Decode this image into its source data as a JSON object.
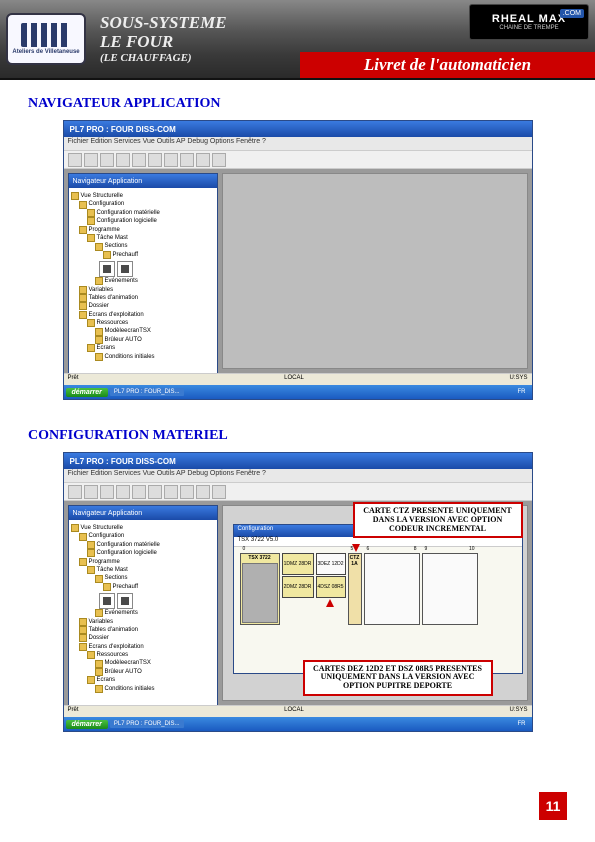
{
  "header": {
    "logo_text": "Ateliers de Villetaneuse",
    "title_l1": "SOUS-SYSTEME",
    "title_l2": "LE FOUR",
    "title_l3": "(LE CHAUFFAGE)",
    "red_banner": "Livret de l'automaticien",
    "brand_l1": "RHEAL",
    "brand_l2": "MAX",
    "brand_com": ".COM",
    "brand_sub": "CHAINE DE TREMPE"
  },
  "sections": {
    "nav_app": "NAVIGATEUR APPLICATION",
    "config_mat": "CONFIGURATION MATERIEL"
  },
  "appwin": {
    "title": "PL7 PRO : FOUR DISS-COM",
    "menu": "Fichier  Edition  Services  Vue  Outils  AP  Debug  Options  Fenêtre  ?",
    "nav_title": "Navigateur Application",
    "status_left": "Prêt",
    "status_mid": "LOCAL",
    "status_right": "U:SYS",
    "taskbar_start": "démarrer",
    "taskbar_task1": "PL7 PRO : FOUR_DIS...",
    "taskbar_tray": "FR"
  },
  "tree": [
    {
      "d": 0,
      "label": "Vue Structurelle"
    },
    {
      "d": 1,
      "label": "Configuration"
    },
    {
      "d": 2,
      "label": "Configuration matérielle"
    },
    {
      "d": 2,
      "label": "Configuration logicielle"
    },
    {
      "d": 1,
      "label": "Programme"
    },
    {
      "d": 2,
      "label": "Tâche Mast"
    },
    {
      "d": 3,
      "label": "Sections"
    },
    {
      "d": 4,
      "label": "Prechauff"
    },
    {
      "d": 3,
      "label": "Evénements"
    },
    {
      "d": 1,
      "label": "Variables"
    },
    {
      "d": 1,
      "label": "Tables d'animation"
    },
    {
      "d": 1,
      "label": "Dossier"
    },
    {
      "d": 1,
      "label": "Ecrans d'exploitation"
    },
    {
      "d": 2,
      "label": "Ressources"
    },
    {
      "d": 3,
      "label": "ModèleecranTSX"
    },
    {
      "d": 3,
      "label": "Brûleur AUTO"
    },
    {
      "d": 2,
      "label": "Ecrans"
    },
    {
      "d": 3,
      "label": "Conditions initiales"
    }
  ],
  "config": {
    "window_title": "Configuration",
    "rack_label": "TSX 3722 V5.0",
    "slots": {
      "cpu_idx": "0",
      "cpu_name": "TSX 3722",
      "cpu_body": "",
      "col_a_top_idx": "1",
      "col_a_top": "DMZ 28DR",
      "col_a_bot_idx": "2",
      "col_a_bot": "DMZ 28DR",
      "col_b_top_idx": "3",
      "col_b_top": "DEZ 12D2",
      "col_b_mid_idx": "4",
      "col_b_mid": "DSZ 08R5",
      "col_c_idx": "5",
      "col_c": "CTZ 1A",
      "col_d_idx_a": "6",
      "col_d_idx_b": "8",
      "col_e_idx_a": "9",
      "col_e_idx_b": "10"
    }
  },
  "callouts": {
    "top": "CARTE CTZ PRESENTE UNIQUEMENT DANS LA VERSION AVEC OPTION CODEUR INCREMENTAL",
    "bottom": "CARTES DEZ 12D2 ET DSZ 08R5 PRESENTES UNIQUEMENT DANS LA VERSION AVEC OPTION PUPITRE DEPORTE"
  },
  "page_number": "11"
}
